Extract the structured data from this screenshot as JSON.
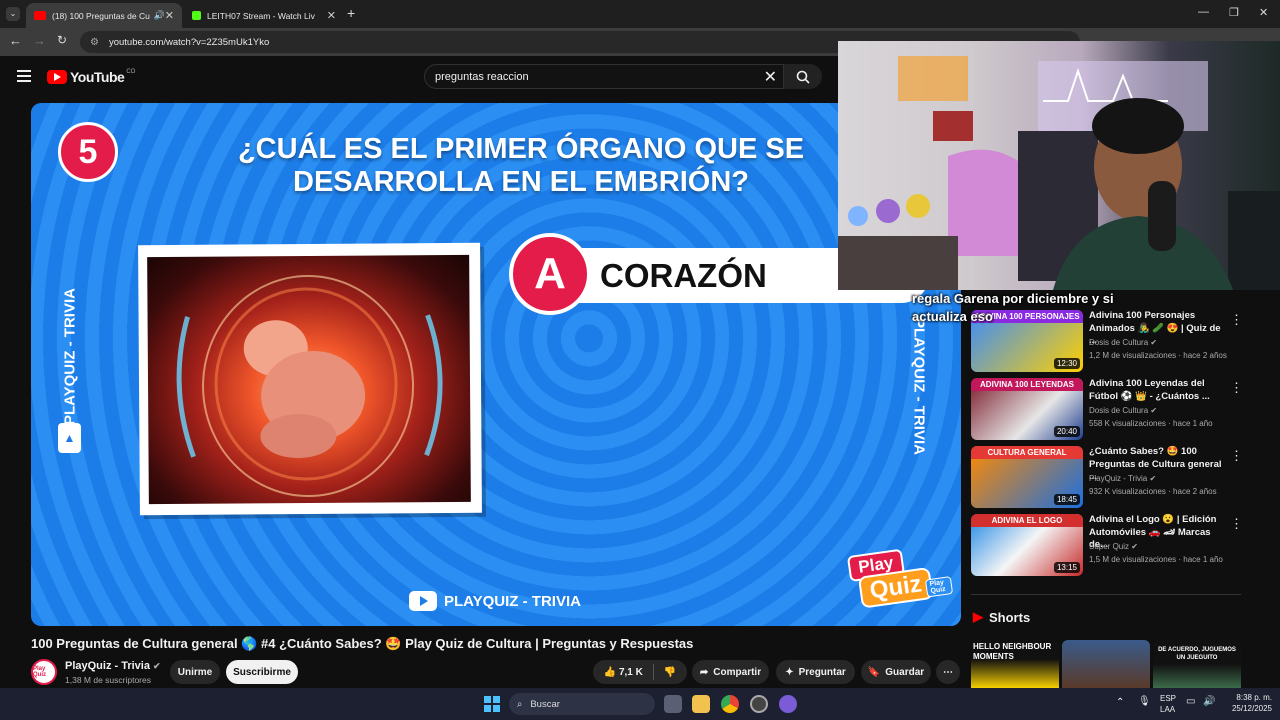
{
  "browser": {
    "tabs": [
      {
        "title": "(18) 100 Preguntas de Cultu",
        "active": true
      },
      {
        "title": "LEITH07 Stream - Watch Live o",
        "active": false
      }
    ],
    "url": "youtube.com/watch?v=2Z35mUk1Yko",
    "window_controls": [
      "—",
      "❐",
      "✕"
    ]
  },
  "youtube": {
    "logo_text": "YouTube",
    "country": "CO",
    "search_value": "preguntas reaccion"
  },
  "video": {
    "question_number": "5",
    "question": "¿CUÁL ES EL PRIMER ÓRGANO QUE SE DESARROLLA EN EL EMBRIÓN?",
    "side_label": "PLAYQUIZ - TRIVIA",
    "answer_letter": "A",
    "answer_text": "CORAZÓN",
    "channel_watermark": "PLAYQUIZ - TRIVIA",
    "logo": {
      "play": "Play",
      "quiz": "Quiz",
      "mini": "Play Quiz"
    }
  },
  "details": {
    "title": "100 Preguntas de Cultura general 🌎 #4 ¿Cuánto Sabes? 🤩 Play Quiz de Cultura | Preguntas y Respuestas",
    "channel_name": "PlayQuiz - Trivia",
    "subscribers": "1,38 M de suscriptores",
    "avatar_text": "Play Quiz",
    "join_label": "Unirme",
    "subscribe_label": "Suscribirme",
    "likes": "7,1 K",
    "share_label": "Compartir",
    "ask_label": "Preguntar",
    "save_label": "Guardar"
  },
  "recommendations": [
    {
      "thumb_band": "ADIVINA 100 PERSONAJES",
      "band_color": "#8a2be2",
      "duration": "12:30",
      "title": "Adivina 100 Personajes Animados 👨‍🎤 🥒 😍 | Quiz de ...",
      "channel": "Dosis de Cultura",
      "meta": "1,2 M de visualizaciones · hace 2 años"
    },
    {
      "thumb_band": "ADIVINA 100 LEYENDAS",
      "band_color": "#c2185b",
      "duration": "20:40",
      "title": "Adivina 100 Leyendas del Fútbol ⚽ 👑 - ¿Cuántos ...",
      "channel": "Dosis de Cultura",
      "meta": "558 K visualizaciones · hace 1 año"
    },
    {
      "thumb_band": "CULTURA GENERAL",
      "band_color": "#e53935",
      "duration": "18:45",
      "title": "¿Cuánto Sabes? 🤩 100 Preguntas de Cultura general ...",
      "channel": "PlayQuiz - Trivia",
      "meta": "932 K visualizaciones · hace 2 años"
    },
    {
      "thumb_band": "ADIVINA EL LOGO",
      "band_color": "#d32f2f",
      "duration": "13:15",
      "title": "Adivina el Logo 😮 | Edición Automóviles 🚗 🏎 Marcas de...",
      "channel": "Super Quiz",
      "meta": "1,5 M de visualizaciones · hace 1 año"
    }
  ],
  "overlay_text": [
    "regala Garena por diciembre y si",
    "actualiza eso"
  ],
  "shorts": {
    "heading": "Shorts",
    "items": [
      "HELLO NEIGHBOUR MOMENTS",
      "",
      "DE ACUERDO, JUGUEMOS UN JUEGUITO"
    ]
  },
  "taskbar": {
    "search_placeholder": "Buscar",
    "lang": "ESP",
    "region": "LAA",
    "time": "8:38 p. m.",
    "date": "25/12/2025"
  },
  "colors": {
    "accent": "#e41c49",
    "video_blue": "#1d7de8",
    "yt_red": "#ff0000"
  }
}
